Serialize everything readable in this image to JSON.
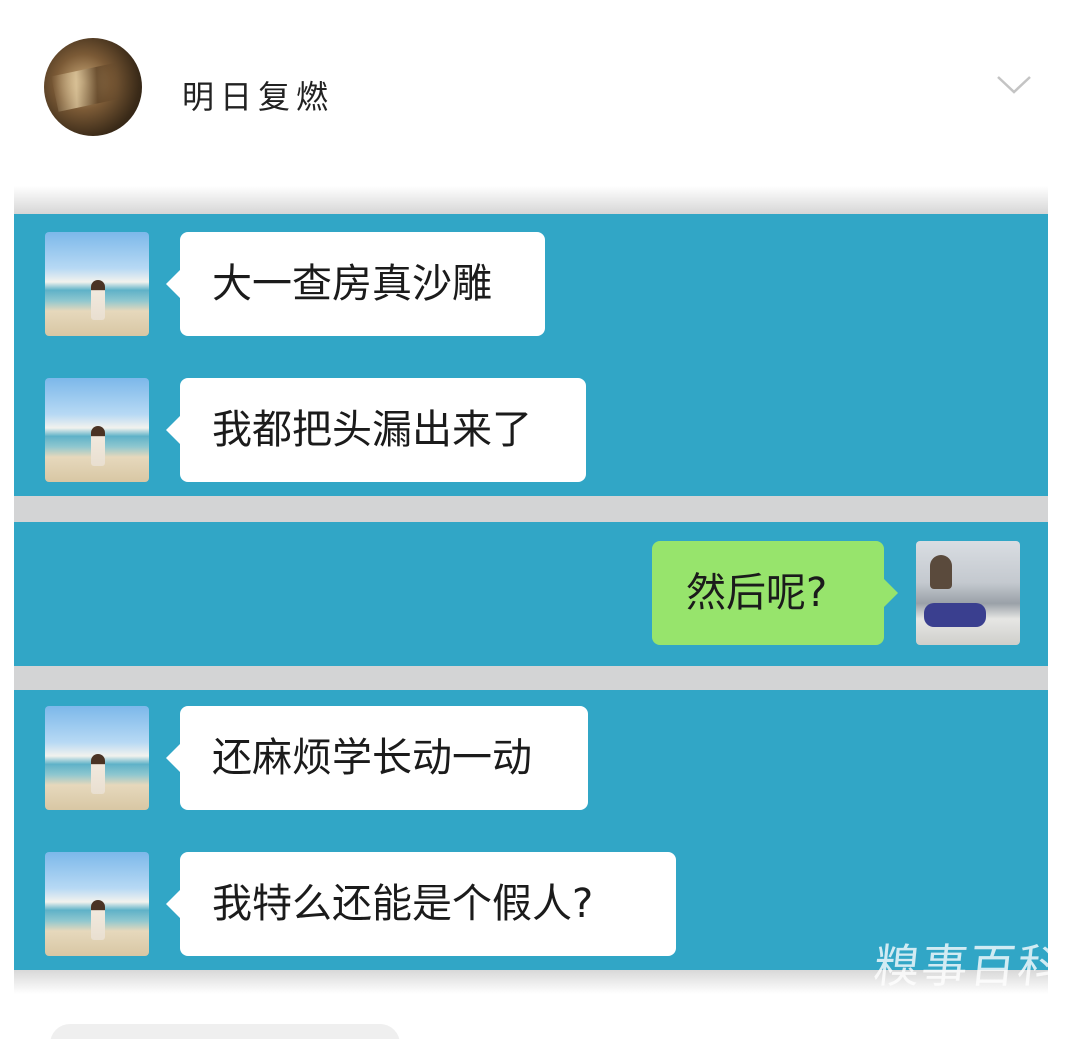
{
  "post": {
    "author_name": "明日复燃"
  },
  "chat": {
    "messages": [
      {
        "side": "left",
        "text": "大一查房真沙雕"
      },
      {
        "side": "left",
        "text": "我都把头漏出来了"
      },
      {
        "side": "right",
        "text": "然后呢?"
      },
      {
        "side": "left",
        "text": "还麻烦学长动一动"
      },
      {
        "side": "left",
        "text": "我特么还能是个假人?"
      }
    ]
  },
  "watermark": "糗事百科",
  "icons": {
    "expand": "chevron-down-icon"
  },
  "colors": {
    "panel_bg": "#31a6c6",
    "incoming_bubble": "#ffffff",
    "outgoing_bubble": "#97e46c",
    "gap": "#d3d4d5"
  }
}
